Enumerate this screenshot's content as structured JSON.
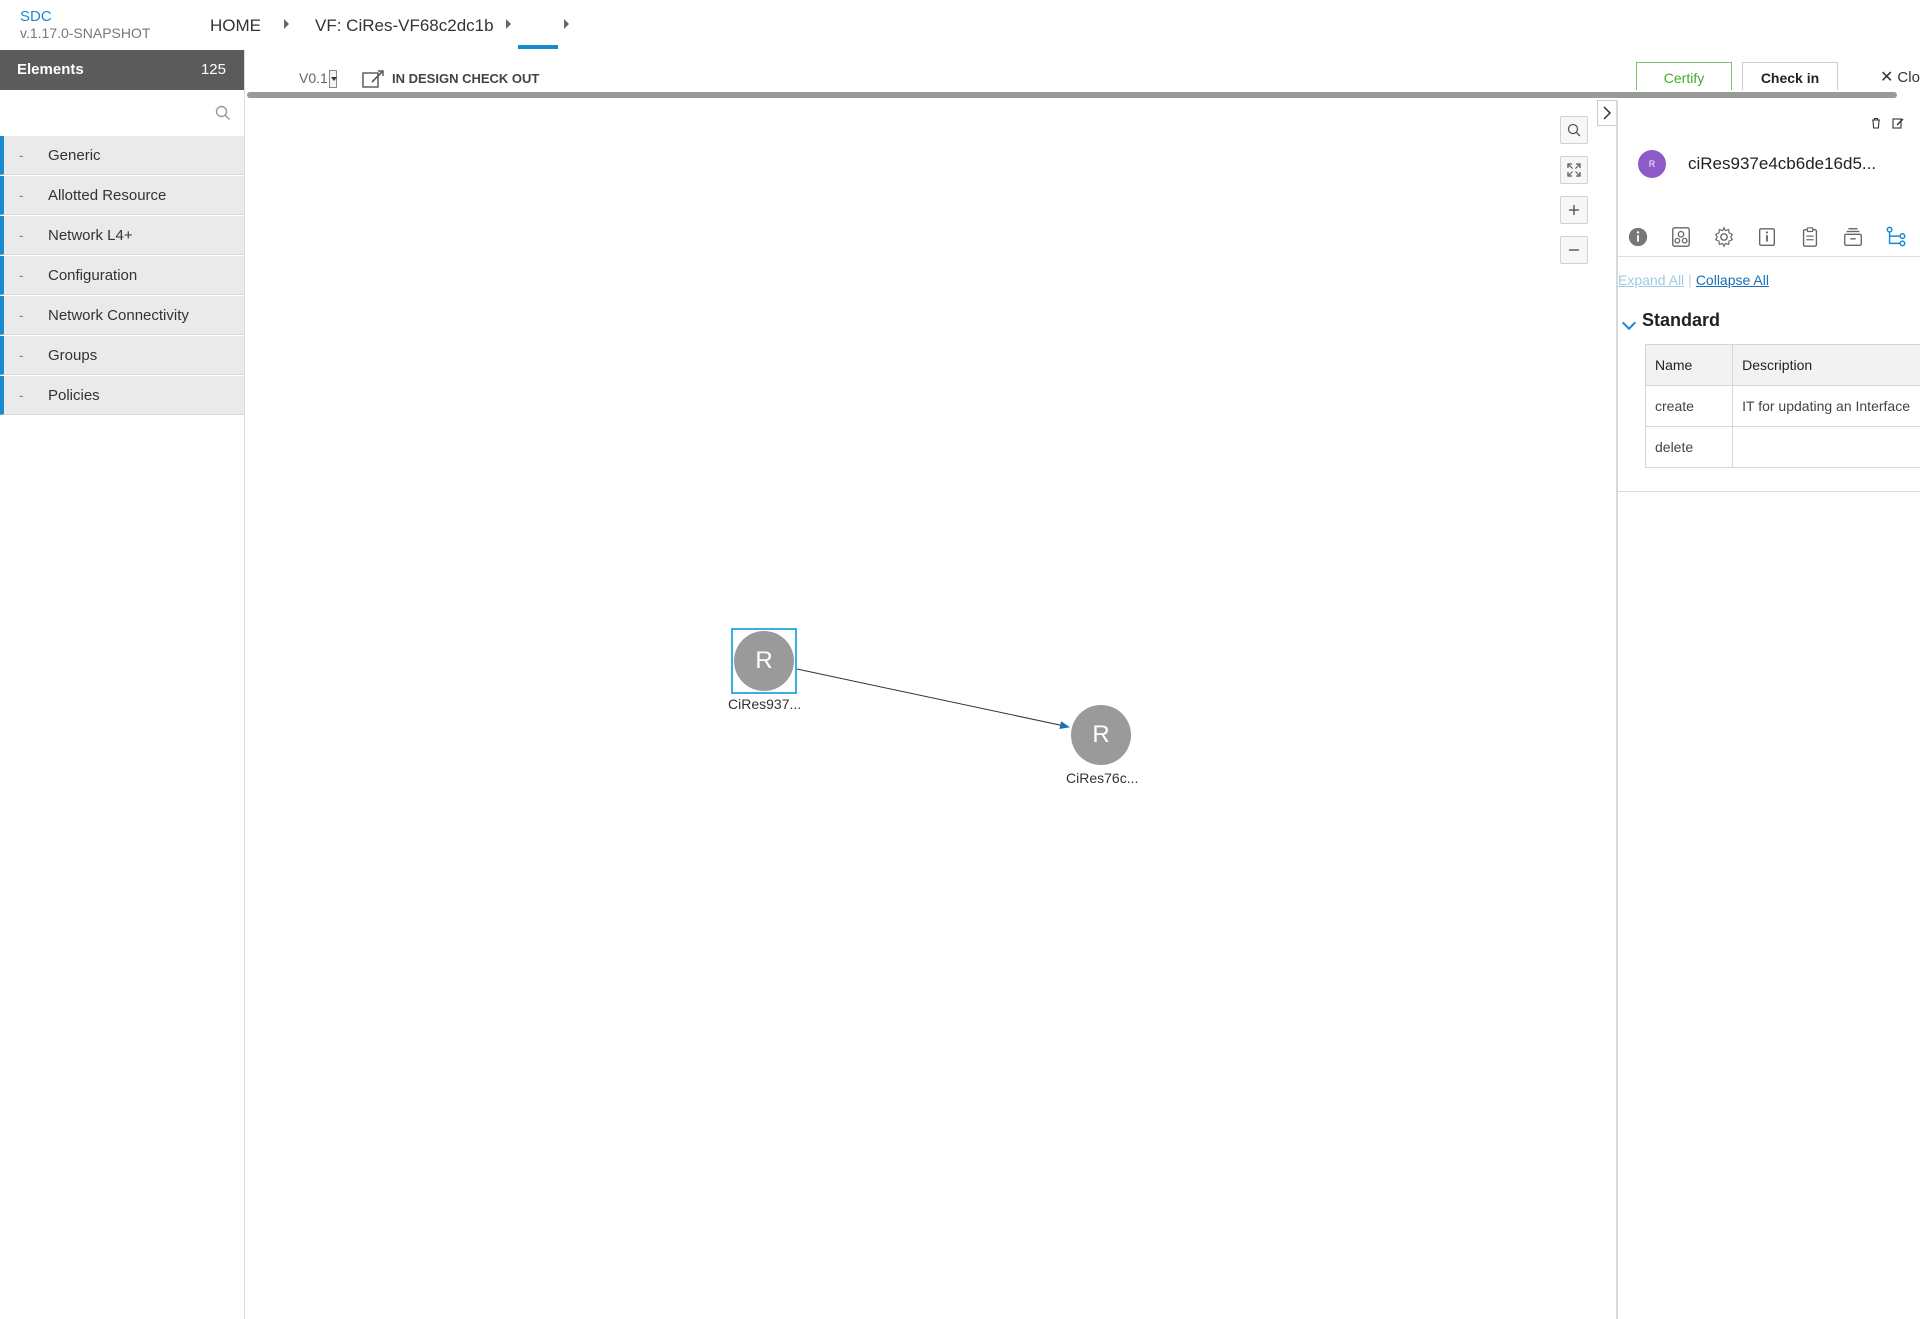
{
  "brand": {
    "name": "SDC",
    "version": "v.1.17.0-SNAPSHOT"
  },
  "breadcrumb": {
    "home": "HOME",
    "vf": "VF: CiRes-VF68c2dc1b"
  },
  "palette": {
    "title": "Elements",
    "count": "125",
    "search_placeholder": "",
    "categories": [
      {
        "label": "Generic"
      },
      {
        "label": "Allotted Resource"
      },
      {
        "label": "Network L4+"
      },
      {
        "label": "Configuration"
      },
      {
        "label": "Network Connectivity"
      },
      {
        "label": "Groups"
      },
      {
        "label": "Policies"
      }
    ]
  },
  "toolbar": {
    "version": "V0.1",
    "status": "IN DESIGN CHECK OUT",
    "certify": "Certify",
    "checkin": "Check in",
    "close": "Clo"
  },
  "diagram": {
    "nodes": [
      {
        "letter": "R",
        "label": "CiRes937...",
        "selected": true
      },
      {
        "letter": "R",
        "label": "CiRes76c...",
        "selected": false
      }
    ]
  },
  "panel": {
    "avatar_letter": "R",
    "component_name": "ciRes937e4cb6de16d5...",
    "expand_all": "Expand All",
    "collapse_all": "Collapse All",
    "section": "Standard",
    "table": {
      "headers": [
        "Name",
        "Description"
      ],
      "rows": [
        [
          "create",
          "IT for updating an Interface"
        ],
        [
          "delete",
          ""
        ]
      ]
    }
  },
  "colors": {
    "accent": "#1a8ad0",
    "certify": "#3fae2a",
    "avatar": "#8e59c9",
    "node": "#9a9a9a",
    "palette_header": "#5b5b5b"
  }
}
